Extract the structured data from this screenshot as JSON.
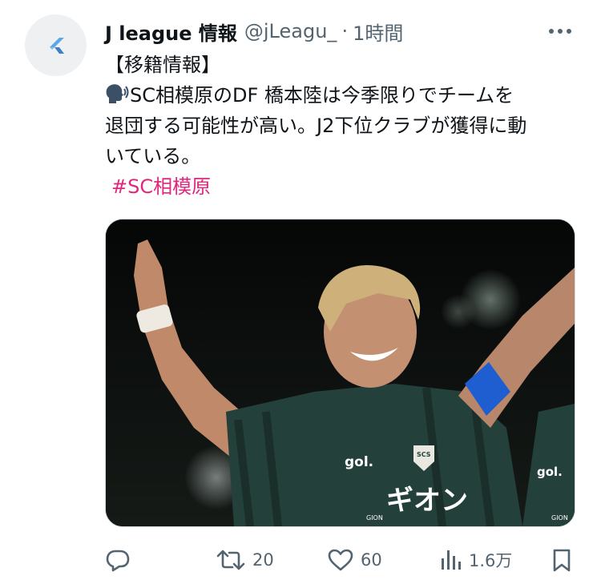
{
  "tweet": {
    "author_name": "J league 情報",
    "handle": "@jLeagu_",
    "separator": "·",
    "time": "1時間",
    "lines": [
      "【移籍情報】",
      "SC相模原のDF 橋本陸は今季限りでチームを",
      "退団する可能性が高い。J2下位クラブが獲得に動",
      "いている。"
    ],
    "hashtag": "#SC相模原",
    "media_text": {
      "shirt_sponsor": "ギオン",
      "shirt_sponsor_small": "GION",
      "brand": "gol.",
      "crest": "SCS"
    }
  },
  "actions": {
    "replies": "",
    "retweets": "20",
    "likes": "60",
    "views": "1.6万"
  },
  "icons": {
    "avatar": "feather-logo-icon",
    "more": "more-dots-icon",
    "speaking": "speaking-head-emoji",
    "reply": "reply-icon",
    "retweet": "retweet-icon",
    "like": "heart-icon",
    "views": "views-bars-icon",
    "bookmark": "bookmark-icon"
  },
  "colors": {
    "text": "#0f1419",
    "secondary": "#536471",
    "hashtag": "#e0267d",
    "avatar_bg": "#eef0f2",
    "avatar_logo": "#5aa7e6"
  }
}
